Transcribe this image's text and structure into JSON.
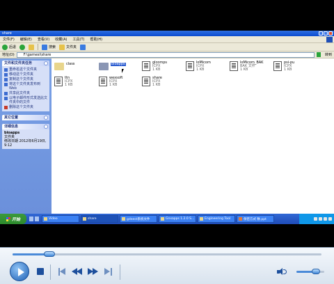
{
  "window": {
    "title": "share"
  },
  "menu": [
    "文件(F)",
    "编辑(E)",
    "查看(V)",
    "收藏(A)",
    "工具(T)",
    "帮助(H)"
  ],
  "toolbar": {
    "back": "后退",
    "search": "搜索",
    "folders": "文件夹"
  },
  "address": {
    "label": "地址(D)",
    "path": "F:\\gamesi\\share",
    "go": "转到"
  },
  "task_pane": {
    "file_tasks": {
      "title": "文件和文件夹任务",
      "items": [
        "重命名这个文件夹",
        "移动这个文件夹",
        "复制这个文件夹",
        "将这个文件夹发布到 Web",
        "共享此文件夹",
        "以电子邮件形式发送此文件夹中的文件",
        "删除这个文件夹"
      ]
    },
    "other_places": {
      "title": "其它位置"
    },
    "details": {
      "title": "详细信息",
      "name": "bioapps",
      "type": "文件夹",
      "modified_label": "修改日期",
      "modified": "2012年6月19日, 9:12"
    }
  },
  "files": [
    {
      "name": "class",
      "meta": "",
      "kind": "folder"
    },
    {
      "name": "bioapps",
      "meta": "",
      "kind": "folder-selected"
    },
    {
      "name": "glcomps",
      "meta": "ICPX\n1 KB",
      "kind": "file"
    },
    {
      "name": "loMicom",
      "meta": "ICPX\n1 KB",
      "kind": "file"
    },
    {
      "name": "loMicom_BAK",
      "meta": "BAK 文件\n1 KB",
      "kind": "file"
    },
    {
      "name": "psi-pu",
      "meta": "ICPX\n1 KB",
      "kind": "file"
    },
    {
      "name": "ttn",
      "meta": "ICPX\n1 KB",
      "kind": "file"
    },
    {
      "name": "wexsoft",
      "meta": "ICPX\n1 KB",
      "kind": "file"
    },
    {
      "name": "share",
      "meta": "ICPX\n1 KB",
      "kind": "file"
    }
  ],
  "taskbar": {
    "start": "开始",
    "tasks": [
      "Video",
      "share",
      "gdeest系统文件",
      "Gnxapps 1.2.0 S...",
      "Engineering Tool",
      "保密方式 数.ppt"
    ]
  },
  "player": {
    "progress": 0.12,
    "volume": 0.7
  }
}
